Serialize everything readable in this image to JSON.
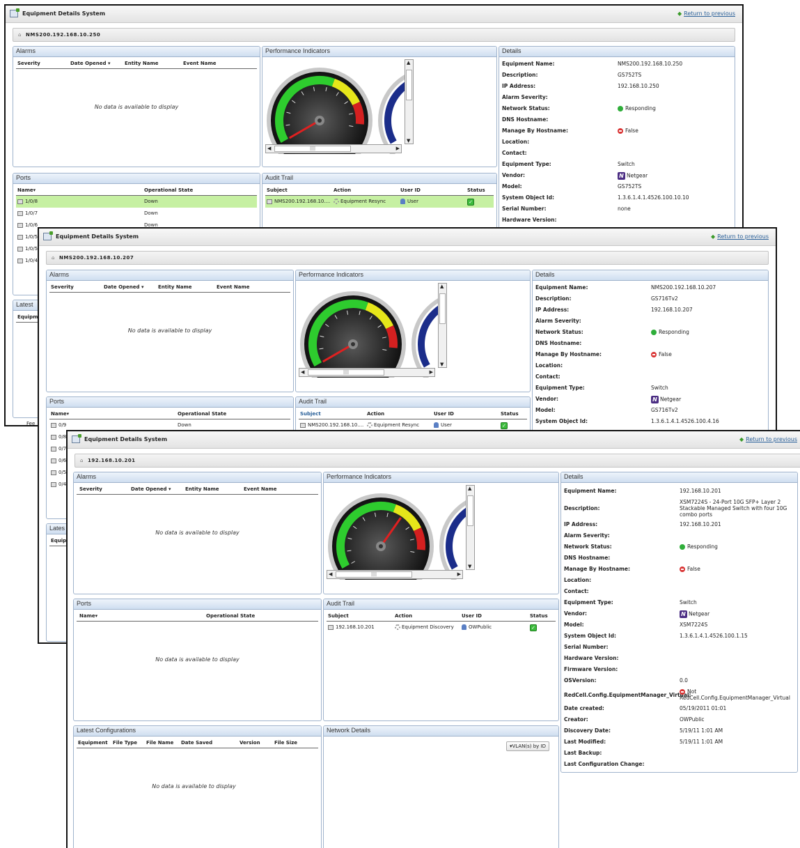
{
  "window_title": "Equipment Details System",
  "return_label": "Return to previous",
  "w1": {
    "crumb": "NMS200.192.168.10.250",
    "alarms": {
      "title": "Alarms",
      "cols": [
        "Severity",
        "Date Opened",
        "Entity Name",
        "Event Name"
      ],
      "empty": "No data is available to display"
    },
    "perf_title": "Performance Indicators",
    "details": {
      "title": "Details",
      "rows": [
        {
          "k": "Equipment Name:",
          "v": "NMS200.192.168.10.250"
        },
        {
          "k": "Description:",
          "v": "GS752TS"
        },
        {
          "k": "IP Address:",
          "v": "192.168.10.250"
        },
        {
          "k": "Alarm Severity:",
          "v": ""
        },
        {
          "k": "Network Status:",
          "v": "Responding",
          "icon": "green-dot"
        },
        {
          "k": "DNS Hostname:",
          "v": ""
        },
        {
          "k": "Manage By Hostname:",
          "v": "False",
          "icon": "red-dot"
        },
        {
          "k": "Location:",
          "v": ""
        },
        {
          "k": "Contact:",
          "v": ""
        },
        {
          "k": "Equipment Type:",
          "v": "Switch"
        },
        {
          "k": "Vendor:",
          "v": "Netgear",
          "icon": "netgear-logo"
        },
        {
          "k": "Model:",
          "v": "GS752TS"
        },
        {
          "k": "System Object Id:",
          "v": "1.3.6.1.4.1.4526.100.10.10"
        },
        {
          "k": "Serial Number:",
          "v": "none"
        },
        {
          "k": "Hardware Version:",
          "v": ""
        }
      ]
    },
    "ports": {
      "title": "Ports",
      "cols": [
        "Name",
        "Operational State"
      ],
      "rows": [
        {
          "name": "1/0/8",
          "state": "Down"
        },
        {
          "name": "1/0/7",
          "state": "Down"
        },
        {
          "name": "1/0/6",
          "state": "Down"
        },
        {
          "name": "1/0/5",
          "state": ""
        },
        {
          "name": "1/0/5",
          "state": ""
        },
        {
          "name": "1/0/4",
          "state": ""
        }
      ]
    },
    "audit": {
      "title": "Audit Trail",
      "cols": [
        "Subject",
        "Action",
        "User ID",
        "Status"
      ],
      "rows": [
        {
          "subject": "NMS200.192.168.10....",
          "action": "Equipment Resync",
          "user": "User"
        }
      ]
    },
    "latest_title": "Latest",
    "latest_col": "Equipme",
    "footer_text": "Fee"
  },
  "w2": {
    "crumb": "NMS200.192.168.10.207",
    "alarms": {
      "title": "Alarms",
      "cols": [
        "Severity",
        "Date Opened",
        "Entity Name",
        "Event Name"
      ],
      "empty": "No data is available to display"
    },
    "perf_title": "Performance Indicators",
    "details": {
      "title": "Details",
      "rows": [
        {
          "k": "Equipment Name:",
          "v": "NMS200.192.168.10.207"
        },
        {
          "k": "Description:",
          "v": "GS716Tv2"
        },
        {
          "k": "IP Address:",
          "v": "192.168.10.207"
        },
        {
          "k": "Alarm Severity:",
          "v": ""
        },
        {
          "k": "Network Status:",
          "v": "Responding",
          "icon": "green-dot"
        },
        {
          "k": "DNS Hostname:",
          "v": ""
        },
        {
          "k": "Manage By Hostname:",
          "v": "False",
          "icon": "red-dot"
        },
        {
          "k": "Location:",
          "v": ""
        },
        {
          "k": "Contact:",
          "v": ""
        },
        {
          "k": "Equipment Type:",
          "v": "Switch"
        },
        {
          "k": "Vendor:",
          "v": "Netgear",
          "icon": "netgear-logo"
        },
        {
          "k": "Model:",
          "v": "GS716Tv2"
        },
        {
          "k": "System Object Id:",
          "v": "1.3.6.1.4.1.4526.100.4.16"
        }
      ]
    },
    "ports": {
      "title": "Ports",
      "cols": [
        "Name",
        "Operational State"
      ],
      "rows": [
        {
          "name": "0/9",
          "state": "Down"
        },
        {
          "name": "0/8",
          "state": ""
        },
        {
          "name": "0/7",
          "state": ""
        },
        {
          "name": "0/6",
          "state": ""
        },
        {
          "name": "0/5",
          "state": ""
        },
        {
          "name": "0/4",
          "state": ""
        }
      ]
    },
    "audit": {
      "title": "Audit Trail",
      "cols": [
        "Subject",
        "Action",
        "User ID",
        "Status"
      ],
      "rows": [
        {
          "subject": "NMS200.192.168.10....",
          "action": "Equipment Resync",
          "user": "User"
        }
      ]
    },
    "latest_title": "Lates",
    "latest_col": "Equip"
  },
  "w3": {
    "crumb": "192.168.10.201",
    "alarms": {
      "title": "Alarms",
      "cols": [
        "Severity",
        "Date Opened",
        "Entity Name",
        "Event Name"
      ],
      "empty": "No data is available to display"
    },
    "perf_title": "Performance Indicators",
    "ports": {
      "title": "Ports",
      "cols": [
        "Name",
        "Operational State"
      ],
      "empty": "No data is available to display"
    },
    "audit": {
      "title": "Audit Trail",
      "cols": [
        "Subject",
        "Action",
        "User ID",
        "Status"
      ],
      "rows": [
        {
          "subject": "192.168.10.201",
          "action": "Equipment Discovery",
          "user": "OWPublic"
        }
      ]
    },
    "configs": {
      "title": "Latest Configurations",
      "cols": [
        "Equipment",
        "File Type",
        "File Name",
        "Date Saved",
        "Version",
        "File Size"
      ],
      "empty": "No data is available to display"
    },
    "network": {
      "title": "Network Details",
      "button": "VLAN(s) by ID"
    },
    "details": {
      "title": "Details",
      "rows": [
        {
          "k": "Equipment Name:",
          "v": "192.168.10.201"
        },
        {
          "k": "Description:",
          "v": "XSM7224S - 24-Port 10G SFP+ Layer 2 Stackable Managed Switch with four 10G combo ports",
          "wrap": true
        },
        {
          "k": "IP Address:",
          "v": "192.168.10.201"
        },
        {
          "k": "Alarm Severity:",
          "v": ""
        },
        {
          "k": "Network Status:",
          "v": "Responding",
          "icon": "green-dot"
        },
        {
          "k": "DNS Hostname:",
          "v": ""
        },
        {
          "k": "Manage By Hostname:",
          "v": "False",
          "icon": "red-dot"
        },
        {
          "k": "Location:",
          "v": ""
        },
        {
          "k": "Contact:",
          "v": ""
        },
        {
          "k": "Equipment Type:",
          "v": "Switch"
        },
        {
          "k": "Vendor:",
          "v": "Netgear",
          "icon": "netgear-logo"
        },
        {
          "k": "Model:",
          "v": "XSM7224S"
        },
        {
          "k": "System Object Id:",
          "v": "1.3.6.1.4.1.4526.100.1.15"
        },
        {
          "k": "Serial Number:",
          "v": ""
        },
        {
          "k": "Hardware Version:",
          "v": ""
        },
        {
          "k": "Firmware Version:",
          "v": ""
        },
        {
          "k": "OSVersion:",
          "v": "0.0"
        },
        {
          "k": "RedCell.Config.EquipmentManager_Virtual:",
          "v": "Not RedCell.Config.EquipmentManager_Virtual",
          "icon": "red-dot",
          "wrap": true
        },
        {
          "k": "Date created:",
          "v": "05/19/2011 01:01"
        },
        {
          "k": "Creator:",
          "v": "OWPublic"
        },
        {
          "k": "Discovery Date:",
          "v": "5/19/11 1:01 AM"
        },
        {
          "k": "Last Modified:",
          "v": "5/19/11 1:01 AM"
        },
        {
          "k": "Last Backup:",
          "v": ""
        },
        {
          "k": "Last Configuration Change:",
          "v": ""
        }
      ]
    }
  }
}
